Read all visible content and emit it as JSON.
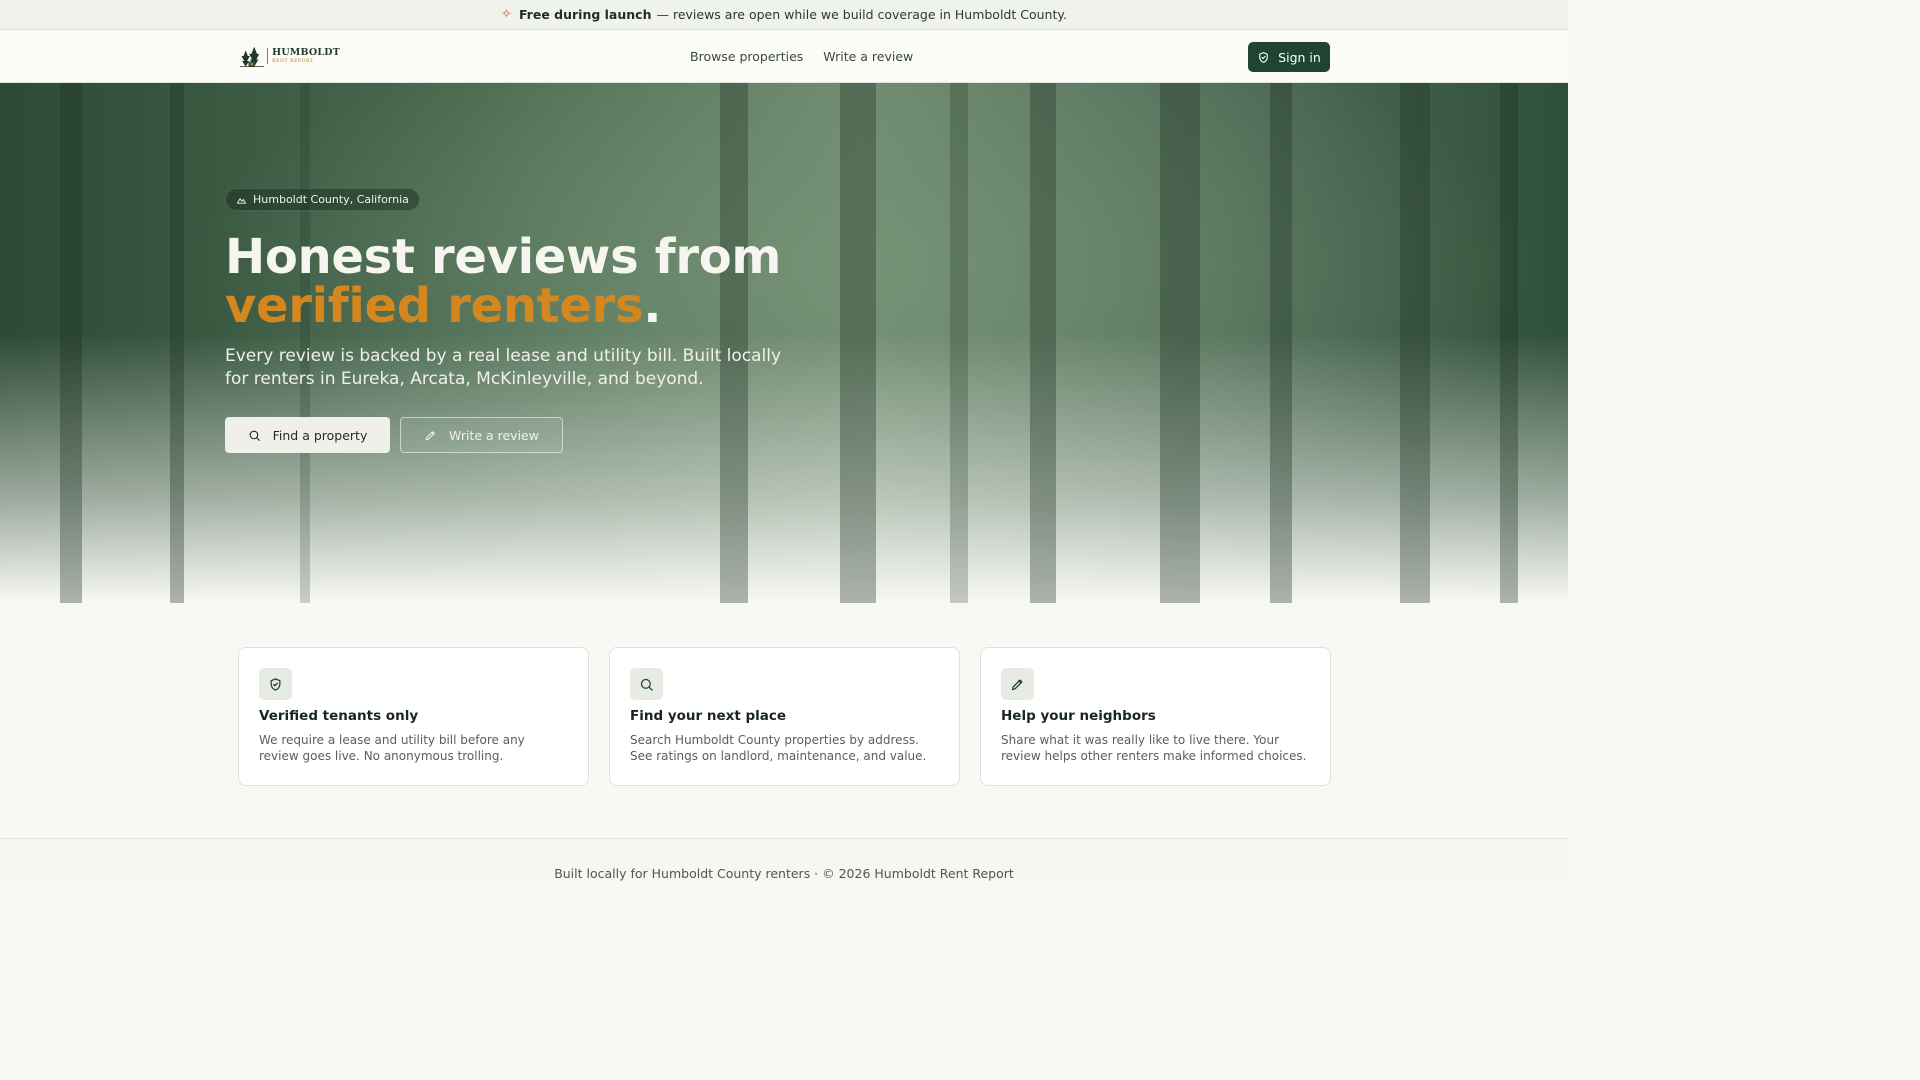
{
  "announcement": {
    "bold": "Free during launch",
    "text": "— reviews are open while we build coverage in Humboldt County."
  },
  "header": {
    "logo_line1": "HUMBOLDT",
    "logo_line2": "RENT REPORT",
    "nav": [
      "Browse properties",
      "Write a review"
    ],
    "signin_label": "Sign in"
  },
  "hero": {
    "badge": "Humboldt County, California",
    "title_part1": "Honest reviews from ",
    "title_accent": "verified renters",
    "title_end": ".",
    "subtitle": "Every review is backed by a real lease and utility bill. Built locally for renters in Eureka, Arcata, McKinleyville, and beyond.",
    "primary_button": "Find a property",
    "secondary_button": "Write a review"
  },
  "features": [
    {
      "icon": "shield-icon",
      "title": "Verified tenants only",
      "text": "We require a lease and utility bill before any review goes live. No anonymous trolling."
    },
    {
      "icon": "search-icon",
      "title": "Find your next place",
      "text": "Search Humboldt County properties by address. See ratings on landlord, maintenance, and value."
    },
    {
      "icon": "pencil-icon",
      "title": "Help your neighbors",
      "text": "Share what it was really like to live there. Your review helps other renters make informed choices."
    }
  ],
  "footer": {
    "text": "Built locally for Humboldt County renters · © 2026 Humboldt Rent Report"
  },
  "colors": {
    "brand_green": "#1f4530",
    "accent_orange": "#d4871f"
  }
}
